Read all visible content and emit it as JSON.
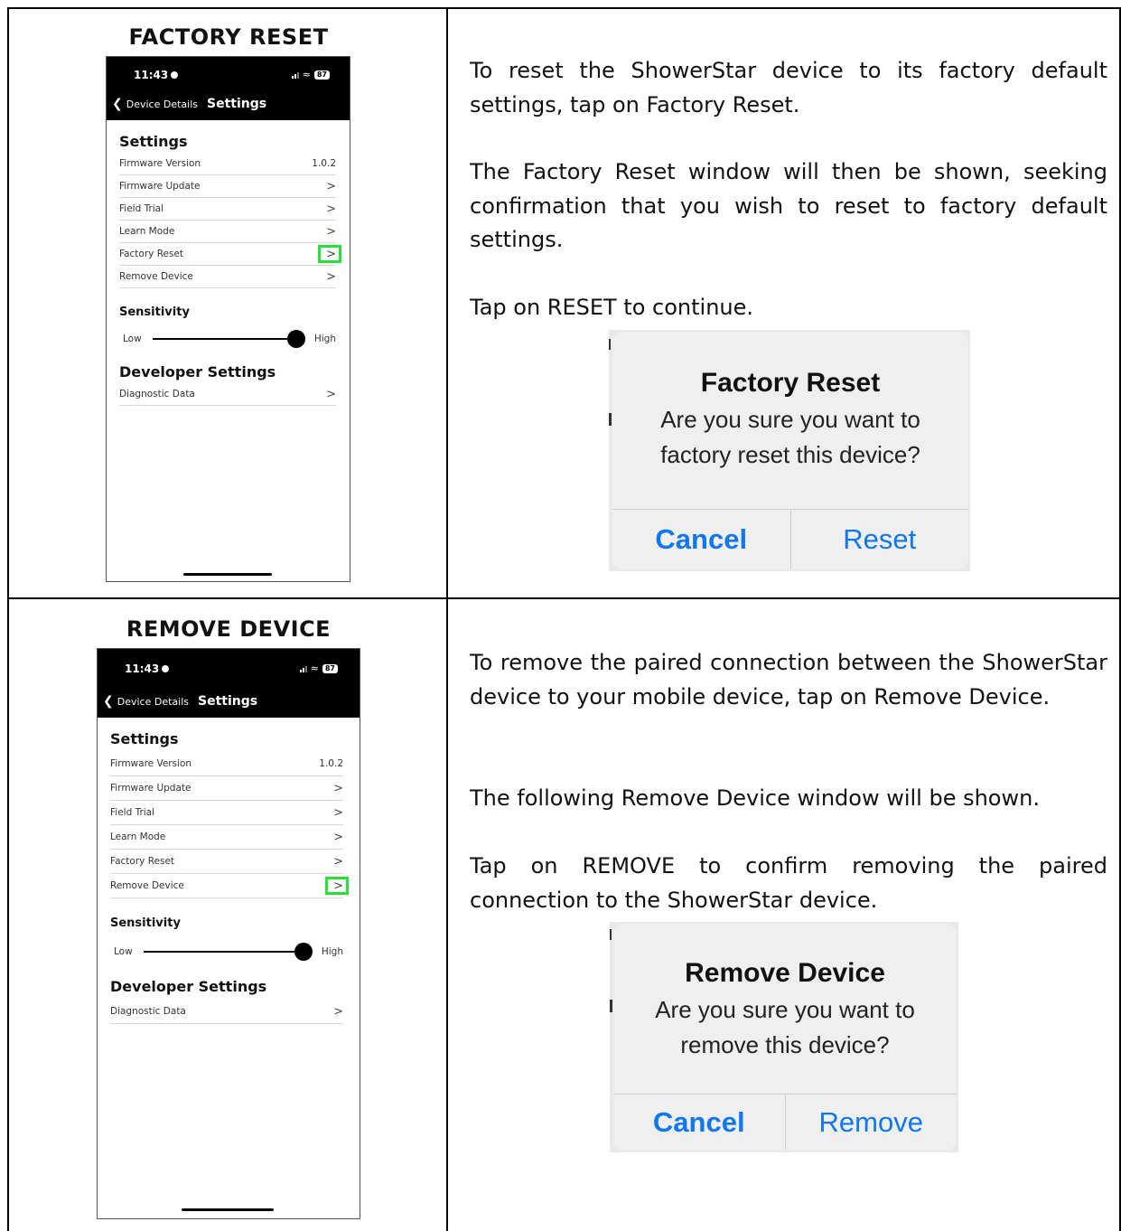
{
  "factory_reset": {
    "title": "FACTORY RESET",
    "para1": "To reset the ShowerStar device to its factory default settings, tap on Factory Reset.",
    "para2": "The Factory Reset window will then be shown, seeking confirmation that you wish to reset to factory default settings.",
    "para3": "Tap on RESET to continue.",
    "dialog": {
      "title": "Factory Reset",
      "line1": "Are you sure you want to",
      "line2": "factory reset this device?",
      "cancel": "Cancel",
      "confirm": "Reset"
    }
  },
  "remove_device": {
    "title": "REMOVE DEVICE",
    "para1": "To remove the paired connection between the ShowerStar device to your mobile device, tap on Remove Device.",
    "para2": "The following Remove Device window will be shown.",
    "para3": "Tap on REMOVE to confirm removing the paired connection to the ShowerStar device.",
    "dialog": {
      "title": "Remove Device",
      "line1": "Are you sure you want to",
      "line2": "remove this device?",
      "cancel": "Cancel",
      "confirm": "Remove"
    }
  },
  "phone": {
    "time": "11:43",
    "battery": "87",
    "back_label": "Device Details",
    "nav_title": "Settings",
    "settings_heading": "Settings",
    "firmware_version_label": "Firmware Version",
    "firmware_version_value": "1.0.2",
    "items": [
      "Firmware Update",
      "Field Trial",
      "Learn Mode",
      "Factory Reset",
      "Remove Device"
    ],
    "sensitivity_heading": "Sensitivity",
    "low": "Low",
    "high": "High",
    "sensitivity_value": 1.0,
    "developer_heading": "Developer Settings",
    "diagnostic": "Diagnostic Data",
    "highlight_color": "#27e03a",
    "icons": {
      "back": "chevron-left-icon",
      "row": "chevron-right-icon",
      "wifi": "wifi-icon",
      "signal": "signal-bars-icon"
    }
  },
  "colors": {
    "dialog_button": "#1177ee"
  }
}
